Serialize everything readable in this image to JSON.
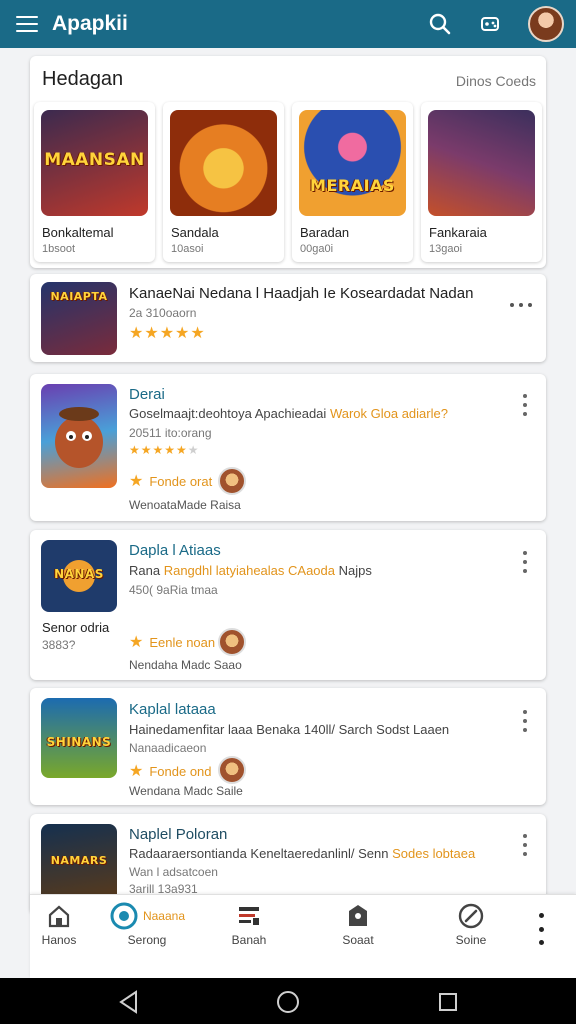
{
  "app": {
    "title": "Apapkii"
  },
  "section": {
    "title": "Hedagan",
    "link": "Dinos Coeds"
  },
  "featured": [
    {
      "name": "Bonkaltemal",
      "sub": "1bsoot",
      "art": "MAANSAN",
      "bg": [
        "#3b2a4f",
        "#c0392b"
      ]
    },
    {
      "name": "Sandala",
      "sub": "10asoi",
      "art": "",
      "bg": [
        "#f39c12",
        "#8e2d0b"
      ]
    },
    {
      "name": "Baradan",
      "sub": "00ga0i",
      "art": "MERAIAS",
      "bg": [
        "#2a4fb0",
        "#f0a030"
      ]
    },
    {
      "name": "Fankaraia",
      "sub": "13gaoi",
      "art": "",
      "bg": [
        "#3b2f5c",
        "#c4502a"
      ]
    }
  ],
  "promo": {
    "title": "KanaeNai Nedana l Haadjah Ie Koseardadat Nadan",
    "meta": "2a 310oaorn",
    "rating": 5,
    "art": "NAIAPTA"
  },
  "list": [
    {
      "title": "Derai",
      "desc": "Goselmaajt:deohtoya Apachieadai",
      "desc_hl": "Warok Gloa adiarle?",
      "meta": "20511 ito:orang",
      "rating": 4,
      "feature": "Fonde orat",
      "dev": "WenoataMade Raisa",
      "art": "",
      "bg": [
        "#6a3fb0",
        "#f07020"
      ]
    },
    {
      "title": "Dapla l Atiaas",
      "desc": "Rana",
      "desc_hl": "Rangdhl latyiahealas CAaoda",
      "desc_tail": " Najps",
      "meta": "450( 9aRia tmaa",
      "side_name": "Senor odria",
      "side_count": "3883?",
      "feature": "Eenle noan",
      "dev": "Nendaha Madc Saao",
      "art": "NANAS",
      "bg": [
        "#1f3b6b",
        "#d05b1a"
      ]
    },
    {
      "title": "Kaplal lataaa",
      "desc": "Hainedamenfitar laaa Benaka 140ll/ Sarch Sodst Laaen",
      "meta": "Nanaadicaeon",
      "feature": "Fonde ond",
      "dev": "Wendana Madc Saile",
      "art": "SHINANS",
      "bg": [
        "#1c6bb0",
        "#7aa82a"
      ]
    },
    {
      "title": "Naplel Poloran",
      "desc": "Radaaraersontianda Keneltaeredanlinl/ Senn",
      "desc_hl": "Sodes lobtaea",
      "meta": "Wan l adsatcoen",
      "meta2": "3arill 13a931",
      "art": "NAMARS",
      "bg": [
        "#15304f",
        "#5a3a1a"
      ]
    }
  ],
  "nav": [
    {
      "label": "Hanos",
      "icon": "home-icon"
    },
    {
      "label": "Serong",
      "icon": "target-icon",
      "active_label": "Naaana"
    },
    {
      "label": "Banah",
      "icon": "news-icon"
    },
    {
      "label": "Soaat",
      "icon": "puzzle-icon"
    },
    {
      "label": "Soine",
      "icon": "compass-icon"
    }
  ],
  "colors": {
    "appbar": "#1a6a87",
    "accent": "#1a6a87",
    "star": "#f5a623",
    "highlight": "#e2941c"
  }
}
